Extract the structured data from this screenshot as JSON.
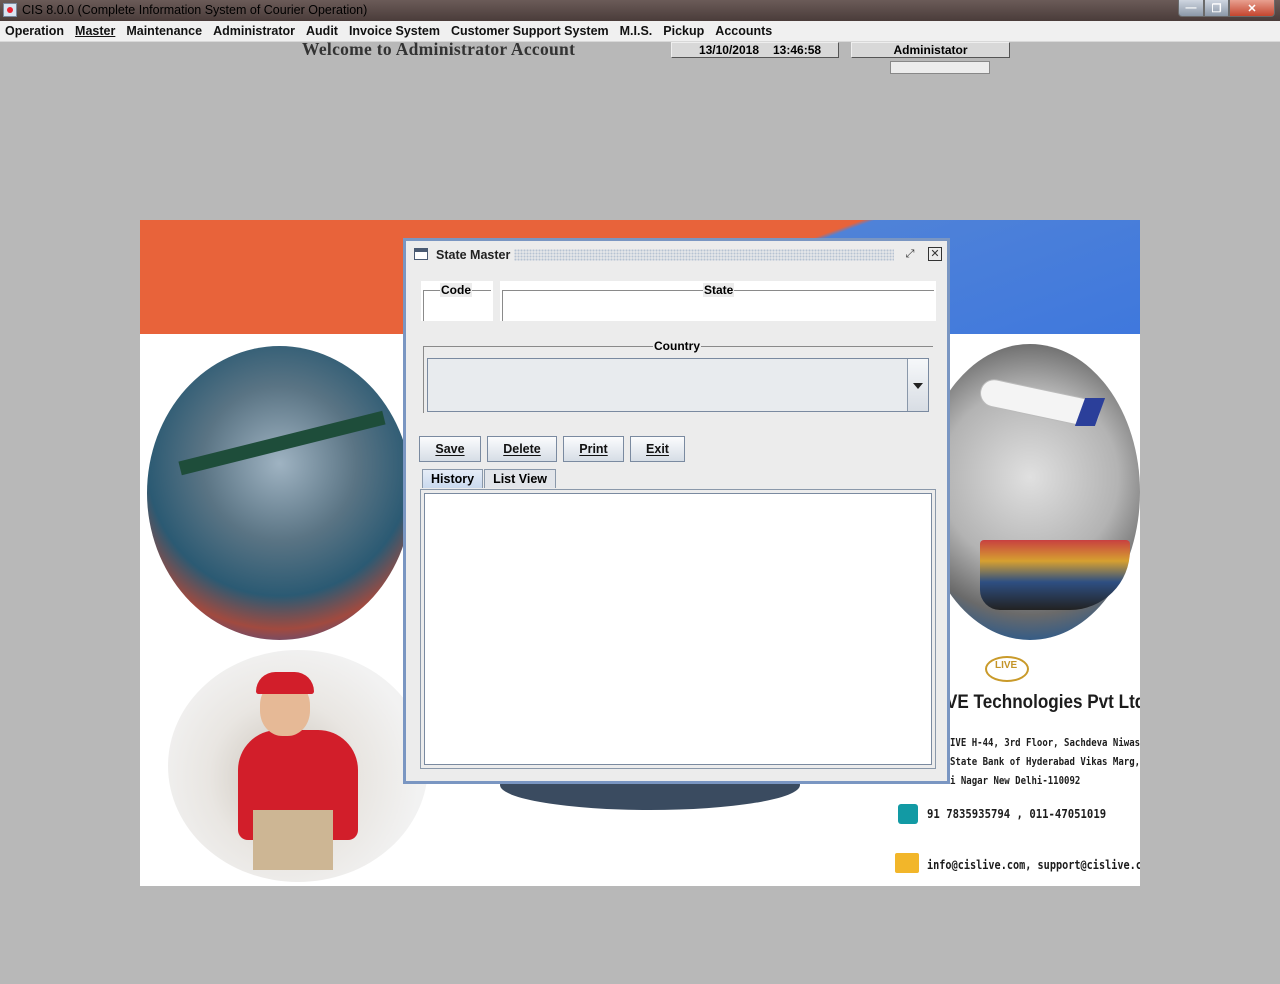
{
  "window": {
    "title": "CIS 8.0.0 (Complete Information System of Courier Operation)",
    "controls": {
      "minimize": "—",
      "maximize": "❐",
      "close": "✕"
    }
  },
  "menubar": {
    "items": [
      "Operation",
      "Master",
      "Maintenance",
      "Administrator",
      "Audit",
      "Invoice System",
      "Customer Support System",
      "M.I.S.",
      "Pickup",
      "Accounts"
    ]
  },
  "header": {
    "welcome": "Welcome to Administrator Account",
    "date": "13/10/2018",
    "time": "13:46:58",
    "user": "Administator"
  },
  "background": {
    "company": "VE Technologies Pvt Ltd",
    "logo": "LIVE",
    "address_lines": [
      "IVE H-44, 3rd Floor, Sachdeva Niwas",
      "State Bank of Hyderabad Vikas Marg,",
      "i Nagar New Delhi-110092"
    ],
    "phone": "91 7835935794 , 011-47051019",
    "email": "info@cislive.com, support@cislive.com"
  },
  "dialog": {
    "title": "State Master",
    "fields": {
      "code_label": "Code",
      "state_label": "State",
      "country_label": "Country",
      "code_value": "",
      "state_value": "",
      "country_value": ""
    },
    "buttons": {
      "save": "Save",
      "delete": "Delete",
      "print": "Print",
      "exit": "Exit"
    },
    "tabs": [
      "History",
      "List View"
    ],
    "active_tab": "History"
  },
  "colors": {
    "titlebar": "#4a3c3a",
    "desktop": "#b8b8b8",
    "dialog_border": "#7a96c2",
    "banner_orange": "#e8633a",
    "banner_blue": "#4f82d8"
  }
}
